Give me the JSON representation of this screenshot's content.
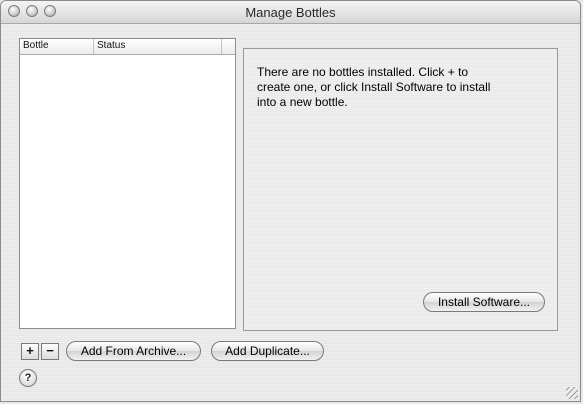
{
  "window": {
    "title": "Manage Bottles"
  },
  "bottles_table": {
    "columns": [
      "Bottle",
      "Status"
    ],
    "rows": []
  },
  "details": {
    "message": "There are no bottles installed.  Click + to create one, or click Install Software to install into a new bottle.",
    "install_label": "Install Software..."
  },
  "toolbar": {
    "add_label": "+",
    "remove_label": "−",
    "archive_label": "Add From Archive...",
    "duplicate_label": "Add Duplicate...",
    "help_label": "?"
  }
}
